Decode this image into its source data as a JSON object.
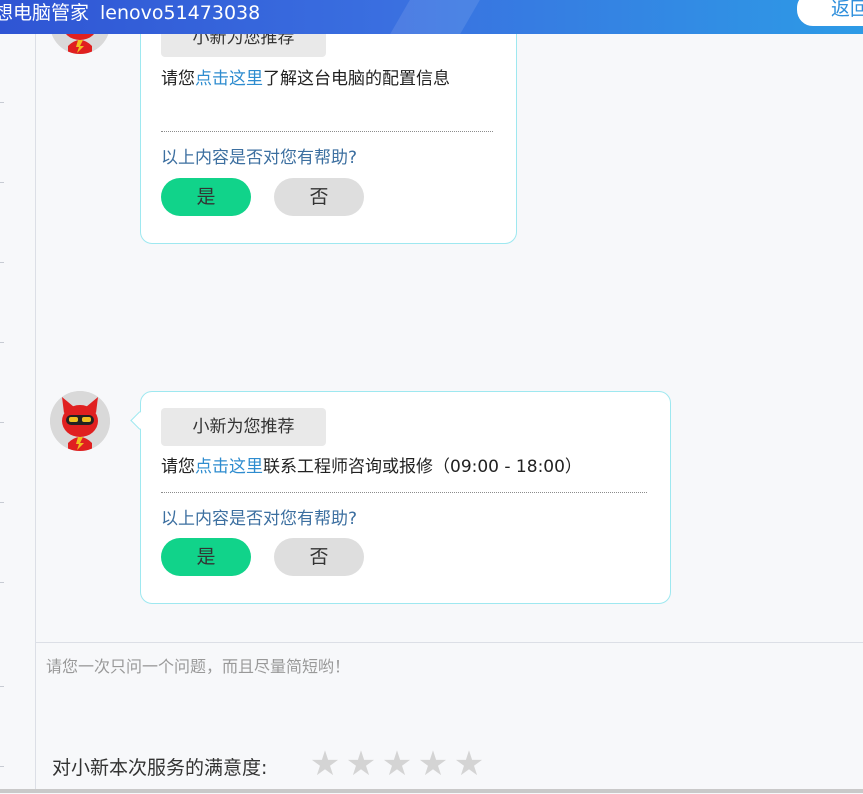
{
  "header": {
    "title": "想电脑管家",
    "device_id": "lenovo51473038",
    "back_label": "返回"
  },
  "messages": [
    {
      "tag": "小新为您推荐",
      "text_before": "请您",
      "link_text": "点击这里",
      "text_after": "了解这台电脑的配置信息",
      "question": "以上内容是否对您有帮助?",
      "yes_label": "是",
      "no_label": "否"
    },
    {
      "tag": "小新为您推荐",
      "text_before": "请您",
      "link_text": "点击这里",
      "text_after": "联系工程师咨询或报修（09:00 - 18:00）",
      "question": "以上内容是否对您有帮助?",
      "yes_label": "是",
      "no_label": "否"
    }
  ],
  "input": {
    "placeholder": "请您一次只问一个问题，而且尽量简短哟！"
  },
  "rating": {
    "label": "对小新本次服务的满意度:",
    "stars_total": 5,
    "stars_selected": 0
  },
  "icons": {
    "avatar": "red-robot-avatar-icon",
    "star": "star-icon"
  },
  "colors": {
    "header_start": "#2f55d4",
    "header_end": "#2d9be6",
    "yes_button": "#11d38a",
    "no_button": "#dedede",
    "link": "#2e8ccf",
    "bubble_border": "#9ee8f0"
  }
}
